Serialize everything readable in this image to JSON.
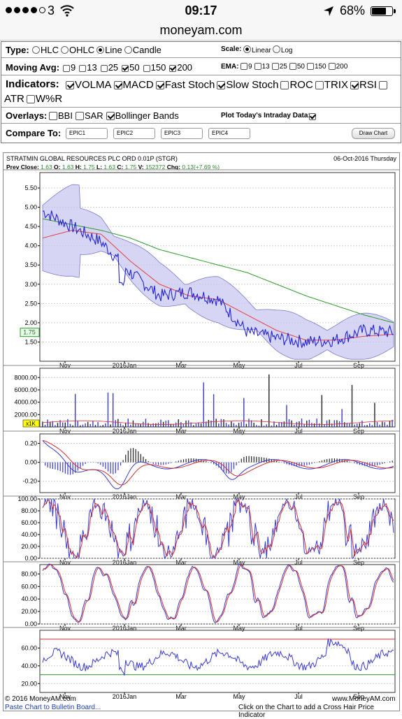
{
  "status": {
    "carrier": "3",
    "time": "09:17",
    "battery": "68%",
    "battery_level": 0.68
  },
  "browser": {
    "url": "moneyam.com"
  },
  "controls": {
    "type_label": "Type:",
    "types": [
      {
        "label": "HLC",
        "on": false
      },
      {
        "label": "OHLC",
        "on": false
      },
      {
        "label": "Line",
        "on": true
      },
      {
        "label": "Candle",
        "on": false
      }
    ],
    "scale_label": "Scale:",
    "scales": [
      {
        "label": "Linear",
        "on": true
      },
      {
        "label": "Log",
        "on": false
      }
    ],
    "mavg_label": "Moving Avg:",
    "mavg": [
      {
        "label": "9",
        "on": false
      },
      {
        "label": "13",
        "on": false
      },
      {
        "label": "25",
        "on": false
      },
      {
        "label": "50",
        "on": true
      },
      {
        "label": "150",
        "on": false
      },
      {
        "label": "200",
        "on": true
      }
    ],
    "ema_label": "EMA:",
    "ema": [
      {
        "label": "9",
        "on": false
      },
      {
        "label": "13",
        "on": false
      },
      {
        "label": "25",
        "on": false
      },
      {
        "label": "50",
        "on": false
      },
      {
        "label": "150",
        "on": false
      },
      {
        "label": "200",
        "on": false
      }
    ],
    "ind_label": "Indicators:",
    "indicators": [
      {
        "label": "VOLMA",
        "on": true
      },
      {
        "label": "MACD",
        "on": true
      },
      {
        "label": "Fast Stoch",
        "on": true
      },
      {
        "label": "Slow Stoch",
        "on": true
      },
      {
        "label": "ROC",
        "on": false
      },
      {
        "label": "TRIX",
        "on": false
      },
      {
        "label": "RSI",
        "on": true
      },
      {
        "label": "ATR",
        "on": false
      },
      {
        "label": "W%R",
        "on": false
      }
    ],
    "ov_label": "Overlays:",
    "overlays": [
      {
        "label": "BBI",
        "on": false
      },
      {
        "label": "SAR",
        "on": false
      },
      {
        "label": "Bollinger Bands",
        "on": true
      }
    ],
    "intraday_label": "Plot Today's Intraday Data:",
    "intraday_on": true,
    "compare_label": "Compare To:",
    "epics": [
      "EPIC1",
      "EPIC2",
      "EPIC3",
      "EPIC4"
    ],
    "draw_button": "Draw Chart"
  },
  "chart": {
    "title": "STRATMIN GLOBAL RESOURCES PLC ORD 0.01P (STGR)",
    "date": "06-Oct-2016 Thursday",
    "quote_prefix": "Prev Close:",
    "prev_close": "1.63",
    "o_label": "O:",
    "o": "1.63",
    "h_label": "H:",
    "h": "1.75",
    "l_label": "L:",
    "l": "1.63",
    "c_label": "C:",
    "c": "1.75",
    "v_label": "V:",
    "v": "152372",
    "chg_label": "Chg:",
    "chg": "0.13(+7.69 %)",
    "last_price": "1.75",
    "x_ticks": [
      "Nov",
      "2016Jan",
      "Mar",
      "May",
      "Jul",
      "Sep"
    ],
    "price_ticks": [
      "5.50",
      "5.00",
      "4.50",
      "4.00",
      "3.50",
      "3.00",
      "2.50",
      "2.00",
      "1.50"
    ],
    "volume_ticks": [
      "8000.00",
      "6000.00",
      "4000.00",
      "2000.00"
    ],
    "volume_unit": "x1K",
    "macd_ticks": [
      "0.20",
      "0.00",
      "-0.20"
    ],
    "stoch_ticks": [
      "100.00",
      "80.00",
      "60.00",
      "40.00",
      "20.00",
      "0.00"
    ],
    "slow_ticks": [
      "80.00",
      "60.00",
      "40.00",
      "20.00",
      "0.00"
    ],
    "rsi_ticks": [
      "60.00",
      "40.00",
      "20.00"
    ],
    "copyright": "© 2016 MoneyAM.com",
    "site": "www.MoneyAM.com",
    "paste_link": "Paste Chart to Bulletin Board...",
    "hint": "Click on the Chart to add a Cross Hair Price Indicator",
    "colors": {
      "price": "#2323d0",
      "ma50": "#e04040",
      "ma200": "#2a9a2a",
      "band": "#c8c8f0"
    }
  },
  "chart_data": {
    "type": "line",
    "title": "STRATMIN GLOBAL RESOURCES PLC ORD 0.01P (STGR)",
    "x": [
      "2015-10",
      "2015-11",
      "2015-12",
      "2016-01",
      "2016-02",
      "2016-03",
      "2016-04",
      "2016-05",
      "2016-06",
      "2016-07",
      "2016-08",
      "2016-09",
      "2016-10"
    ],
    "series": [
      {
        "values": [
          4.9,
          4.5,
          4.1,
          3.3,
          2.7,
          2.8,
          2.6,
          1.75,
          1.6,
          1.5,
          1.55,
          1.8,
          1.75
        ]
      },
      {
        "values": [
          4.2,
          4.4,
          4.3,
          3.6,
          3.0,
          2.7,
          2.6,
          2.2,
          1.8,
          1.55,
          1.55,
          1.65,
          1.7
        ]
      },
      {
        "values": [
          4.7,
          4.55,
          4.4,
          4.2,
          3.9,
          3.7,
          3.5,
          3.3,
          3.0,
          2.7,
          2.45,
          2.2,
          2.0
        ]
      }
    ],
    "ylim": [
      1.0,
      5.9
    ]
  }
}
